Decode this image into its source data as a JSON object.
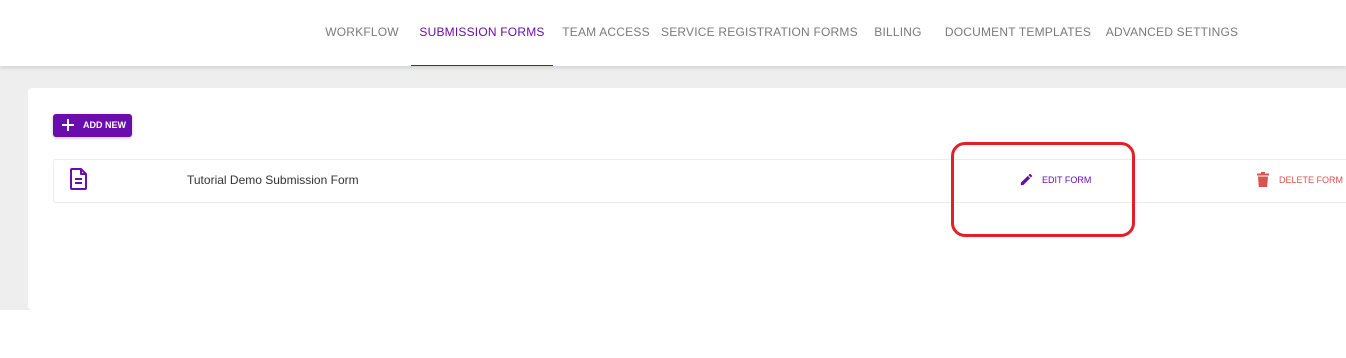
{
  "nav": {
    "tabs": [
      {
        "label": "WORKFLOW",
        "active": false
      },
      {
        "label": "SUBMISSION FORMS",
        "active": true
      },
      {
        "label": "TEAM ACCESS",
        "active": false
      },
      {
        "label": "SERVICE REGISTRATION FORMS",
        "active": false
      },
      {
        "label": "BILLING",
        "active": false
      },
      {
        "label": "DOCUMENT TEMPLATES",
        "active": false
      },
      {
        "label": "ADVANCED SETTINGS",
        "active": false
      }
    ]
  },
  "toolbar": {
    "add_new_label": "ADD NEW",
    "add_icon": "plus-icon"
  },
  "forms": [
    {
      "name": "Tutorial Demo Submission Form",
      "icon": "document-icon",
      "edit_label": "EDIT FORM",
      "edit_icon": "pencil-icon",
      "delete_label": "DELETE FORM",
      "delete_icon": "trash-icon"
    }
  ],
  "colors": {
    "accent": "#6a0dad",
    "danger": "#d9534f",
    "highlight": "#e3202a",
    "background": "#eeeeee"
  }
}
